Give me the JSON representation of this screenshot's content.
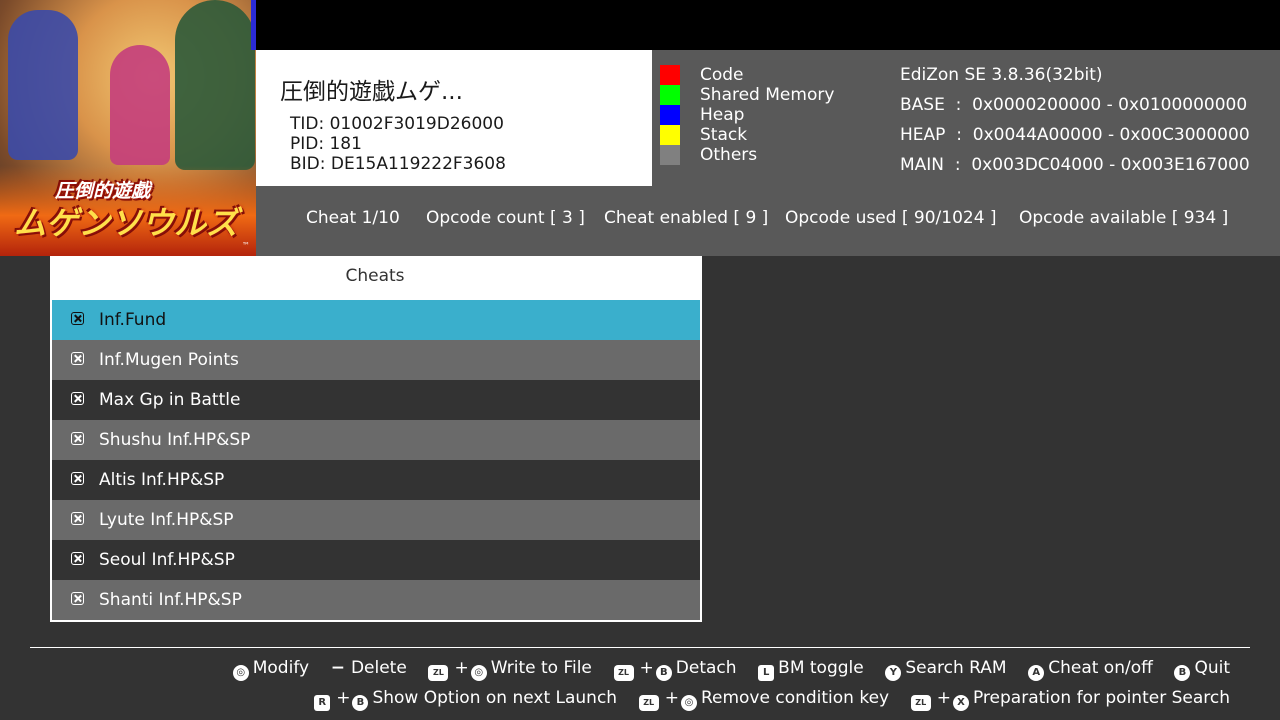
{
  "game": {
    "art_text_line1": "圧倒的遊戯",
    "art_text_line2": "ムゲンソウルズ",
    "art_tm": "™"
  },
  "info": {
    "title": "圧倒的遊戯ムゲ...",
    "tid": "TID: 01002F3019D26000",
    "pid": "PID: 181",
    "bid": "BID: DE15A119222F3608"
  },
  "legend": [
    {
      "label": "Code",
      "color": "#ff0000"
    },
    {
      "label": "Shared Memory",
      "color": "#00ff00"
    },
    {
      "label": "Heap",
      "color": "#0000ff"
    },
    {
      "label": "Stack",
      "color": "#ffff00"
    },
    {
      "label": "Others",
      "color": "#808080"
    }
  ],
  "meminfo": {
    "version": "EdiZon SE 3.8.36(32bit)",
    "base": "BASE  :  0x0000200000 - 0x0100000000",
    "heap": "HEAP  :  0x0044A00000 - 0x00C3000000",
    "main": "MAIN  :  0x003DC04000 - 0x003E167000"
  },
  "status": {
    "cheat": "Cheat 1/10",
    "opcode_count": "Opcode count [ 3 ]",
    "cheat_enabled": "Cheat enabled [ 9 ]",
    "opcode_used": "Opcode used [ 90/1024 ]",
    "opcode_available": "Opcode available [ 934 ]"
  },
  "cheats": {
    "header": "Cheats",
    "items": [
      {
        "label": "Inf.Fund"
      },
      {
        "label": "Inf.Mugen Points"
      },
      {
        "label": "Max Gp in Battle"
      },
      {
        "label": "Shushu Inf.HP&SP"
      },
      {
        "label": "Altis Inf.HP&SP"
      },
      {
        "label": "Lyute Inf.HP&SP"
      },
      {
        "label": "Seoul Inf.HP&SP"
      },
      {
        "label": "Shanti Inf.HP&SP"
      }
    ]
  },
  "hints": {
    "modify": "Modify",
    "delete": "Delete",
    "write_to_file": "Write to File",
    "detach": "Detach",
    "bm_toggle": "BM toggle",
    "search_ram": "Search RAM",
    "cheat_onoff": "Cheat on/off",
    "quit": "Quit",
    "show_option": "Show Option on next Launch",
    "remove_condition": "Remove condition key",
    "pointer_search": "Preparation for pointer Search",
    "plus": "+",
    "minus_glyph": "−",
    "btn_zl": "ZL",
    "btn_b": "B",
    "btn_l": "L",
    "btn_y": "Y",
    "btn_a": "A",
    "btn_r": "R",
    "btn_x": "X",
    "btn_stick": "◎"
  },
  "colors": {
    "selected_row": "#3aafcc",
    "panel_gray": "#595959",
    "background": "#333333"
  }
}
